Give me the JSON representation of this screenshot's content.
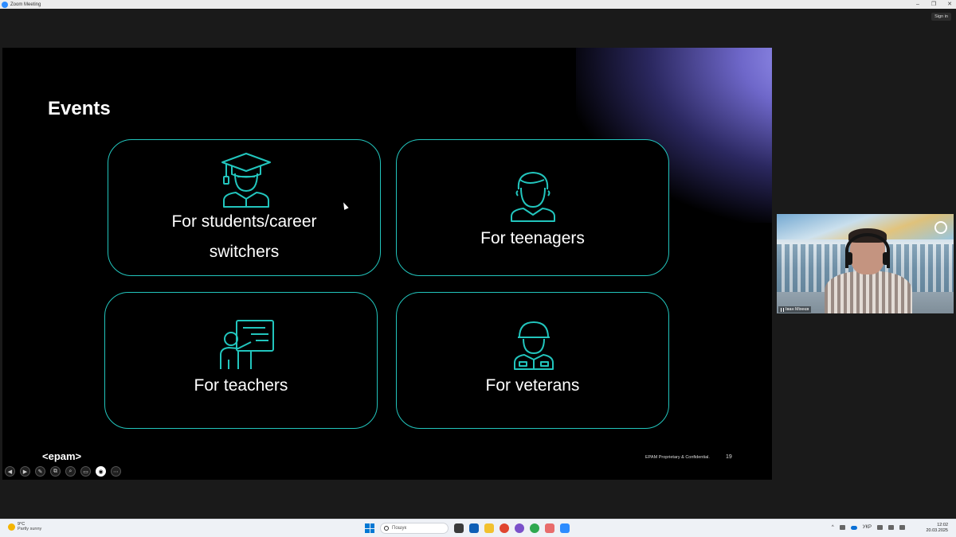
{
  "window": {
    "title": "Zoom Meeting",
    "controls": [
      "–",
      "❐",
      "✕"
    ]
  },
  "zoom": {
    "sign_in": "Sign in"
  },
  "slide": {
    "title": "Events",
    "cards": [
      {
        "label_line1": "For students/career",
        "label_line2": "switchers",
        "icon": "graduate-icon"
      },
      {
        "label": "For teenagers",
        "icon": "teenager-icon"
      },
      {
        "label": "For teachers",
        "icon": "teacher-icon"
      },
      {
        "label": "For veterans",
        "icon": "veteran-icon"
      }
    ],
    "logo": "<epam>",
    "footer": "EPAM Proprietary & Confidential.",
    "page_number": "19",
    "accent_color": "#22c5bd"
  },
  "slide_tools": [
    "◀",
    "▶",
    "✎",
    "⧉",
    "⌕",
    "▭",
    "◉",
    "⋯"
  ],
  "video": {
    "participant_name": "Іван Міхеєв"
  },
  "taskbar": {
    "weather_temp": "9°C",
    "weather_condition": "Partly sunny",
    "search_placeholder": "Пошук",
    "language": "УКР",
    "time": "12:02",
    "date": "20.03.2025"
  }
}
